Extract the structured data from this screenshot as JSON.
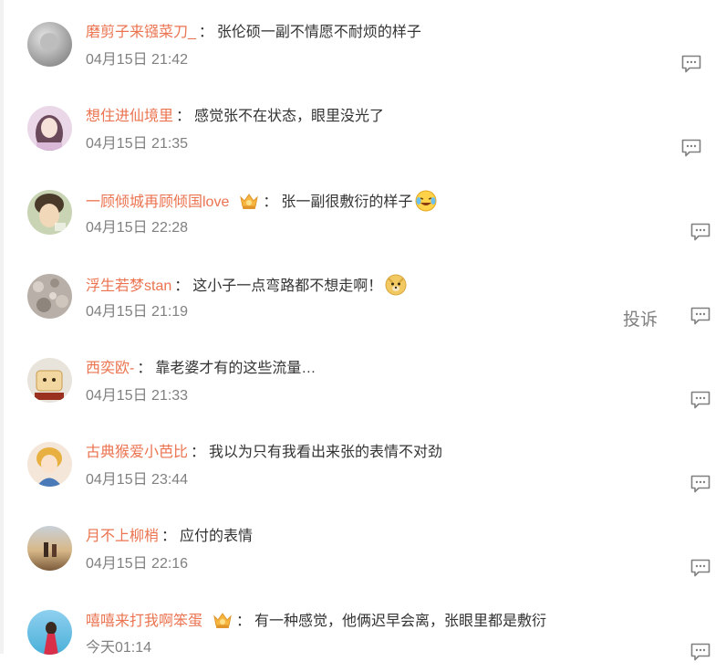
{
  "comments": [
    {
      "username": "磨剪子来镪菜刀_",
      "text": "张伦硕一副不情愿不耐烦的样子",
      "time": "04月15日 21:42"
    },
    {
      "username": "想住进仙境里",
      "text": "感觉张不在状态，眼里没光了",
      "time": "04月15日 21:35"
    },
    {
      "username": "一顾倾城再顾倾国love",
      "text": "张一副很敷衍的样子",
      "time": "04月15日 22:28",
      "badge": "crown-badge-icon",
      "emoji": "laughing-tears-emoji"
    },
    {
      "username": "浮生若梦stan",
      "text": "这小子一点弯路都不想走啊！",
      "time": "04月15日 21:19",
      "emoji": "doge-emoji"
    },
    {
      "username": "西奕欧-",
      "text": "靠老婆才有的这些流量…",
      "time": "04月15日 21:33"
    },
    {
      "username": "古典猴爱小芭比",
      "text": "我以为只有我看出来张的表情不对劲",
      "time": "04月15日 23:44"
    },
    {
      "username": "月不上柳梢",
      "text": "应付的表情",
      "time": "04月15日 22:16"
    },
    {
      "username": "嘻嘻来打我啊笨蛋",
      "text": "有一种感觉，他俩迟早会离，张眼里都是敷衍",
      "time": "今天01:14",
      "badge": "crown-badge-icon"
    }
  ],
  "separator": "：",
  "report_label": "投诉",
  "colors": {
    "username": "#eb7350",
    "text": "#333333",
    "time": "#808080"
  }
}
